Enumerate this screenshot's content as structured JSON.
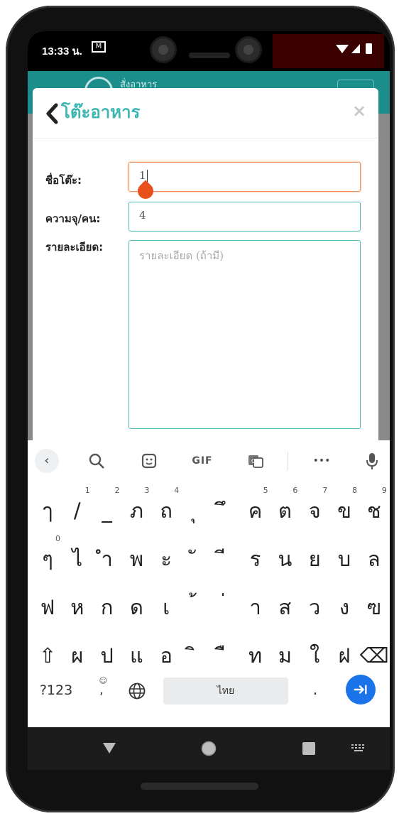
{
  "status": {
    "time": "13:33 น.",
    "mail_icon": "gmail-icon",
    "wifi_icon": "wifi-icon",
    "signal_icon": "signal-icon",
    "battery_icon": "battery-icon"
  },
  "background_app": {
    "header_text": "สั่งอาหาร"
  },
  "modal": {
    "title": "โต๊ะอาหาร",
    "close": "×",
    "fields": {
      "name_label": "ชื่อโต๊ะ:",
      "name_value": "1",
      "capacity_label": "ความจุ/คน:",
      "capacity_value": "4",
      "detail_label": "รายละเอียด:",
      "detail_placeholder": "รายละเอียด (ถ้ามี)"
    }
  },
  "keyboard": {
    "suggestions": [
      "‹",
      "search-icon",
      "sticker-icon",
      "GIF",
      "translate-icon",
      "•••",
      "mic-icon"
    ],
    "gif_label": "GIF",
    "more_label": "•••",
    "row1": [
      {
        "k": "ๅ",
        "h": ""
      },
      {
        "k": "/",
        "h": "1"
      },
      {
        "k": "_",
        "h": "2"
      },
      {
        "k": "ภ",
        "h": "3"
      },
      {
        "k": "ถ",
        "h": "4"
      },
      {
        "k": "ุ",
        "h": ""
      },
      {
        "k": "ึ",
        "h": ""
      },
      {
        "k": "ค",
        "h": "5"
      },
      {
        "k": "ต",
        "h": "6"
      },
      {
        "k": "จ",
        "h": "7"
      },
      {
        "k": "ข",
        "h": "8"
      },
      {
        "k": "ช",
        "h": "9"
      }
    ],
    "row2": [
      {
        "k": "ๆ",
        "h": "0"
      },
      {
        "k": "ไ",
        "h": ""
      },
      {
        "k": "ำ",
        "h": ""
      },
      {
        "k": "พ",
        "h": ""
      },
      {
        "k": "ะ",
        "h": ""
      },
      {
        "k": "ั",
        "h": ""
      },
      {
        "k": "ี",
        "h": ""
      },
      {
        "k": "ร",
        "h": ""
      },
      {
        "k": "น",
        "h": ""
      },
      {
        "k": "ย",
        "h": ""
      },
      {
        "k": "บ",
        "h": ""
      },
      {
        "k": "ล",
        "h": ""
      }
    ],
    "row3": [
      {
        "k": "ฟ",
        "h": ""
      },
      {
        "k": "ห",
        "h": ""
      },
      {
        "k": "ก",
        "h": ""
      },
      {
        "k": "ด",
        "h": ""
      },
      {
        "k": "เ",
        "h": ""
      },
      {
        "k": "้",
        "h": ""
      },
      {
        "k": "่",
        "h": ""
      },
      {
        "k": "า",
        "h": ""
      },
      {
        "k": "ส",
        "h": ""
      },
      {
        "k": "ว",
        "h": ""
      },
      {
        "k": "ง",
        "h": ""
      },
      {
        "k": "ฃ",
        "h": ""
      }
    ],
    "row4": [
      {
        "k": "⇧",
        "h": ""
      },
      {
        "k": "ผ",
        "h": ""
      },
      {
        "k": "ป",
        "h": ""
      },
      {
        "k": "แ",
        "h": ""
      },
      {
        "k": "อ",
        "h": ""
      },
      {
        "k": "ิ",
        "h": ""
      },
      {
        "k": "ื",
        "h": ""
      },
      {
        "k": "ท",
        "h": ""
      },
      {
        "k": "ม",
        "h": ""
      },
      {
        "k": "ใ",
        "h": ""
      },
      {
        "k": "ฝ",
        "h": ""
      },
      {
        "k": "⌫",
        "h": ""
      }
    ],
    "sym_label": "?123",
    "comma_label": ",",
    "comma_hint": "☺",
    "space_label": "ไทย",
    "period_label": "."
  }
}
